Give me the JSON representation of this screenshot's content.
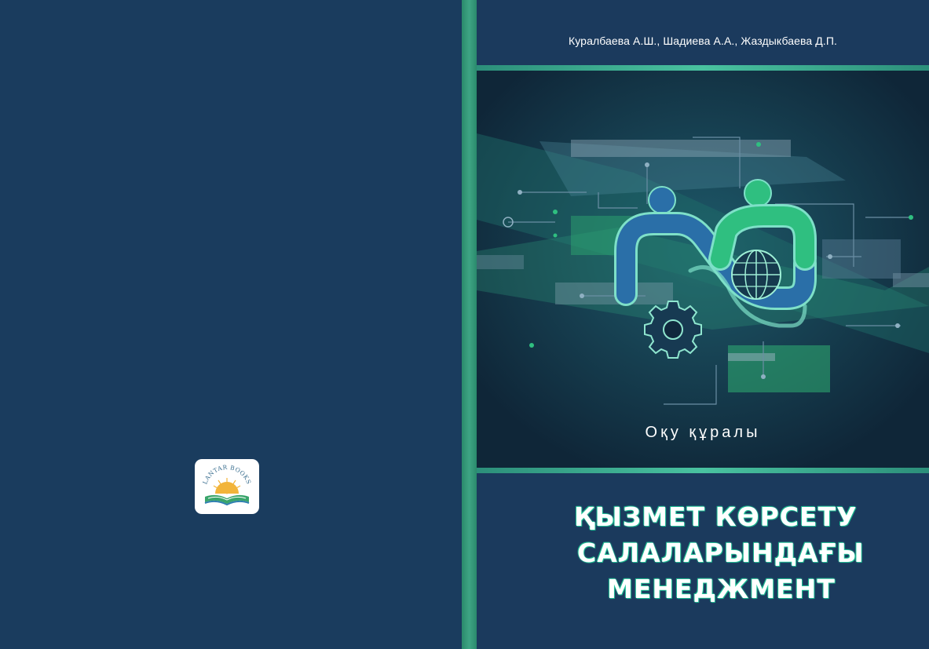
{
  "back_cover": {
    "logo": {
      "publisher": "LANTAR BOOKS"
    }
  },
  "front_cover": {
    "authors": "Куралбаева А.Ш., Шадиева А.А., Жаздыкбаева Д.П.",
    "subtitle": "Оқу құралы",
    "title_lines": [
      "ҚЫЗМЕТ КӨРСЕТУ",
      "САЛАЛАРЫНДАҒЫ",
      "МЕНЕДЖМЕНТ"
    ]
  },
  "colors": {
    "background": "#1a3c5e",
    "spine": "#3ea584",
    "accent": "#49c2a0",
    "title_glow": "#2bd8a8"
  },
  "icons": [
    "people-handshake-icon",
    "globe-icon",
    "gear-icon",
    "open-book-icon",
    "sunrise-icon"
  ]
}
